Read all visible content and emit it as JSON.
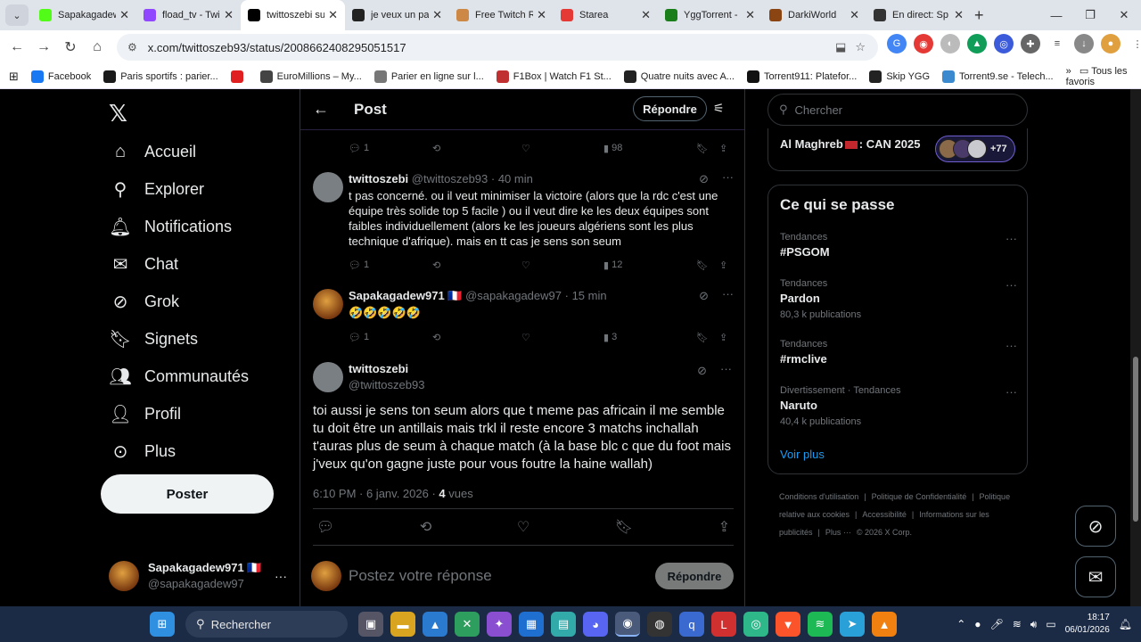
{
  "browser": {
    "tabs": [
      {
        "title": "Sapakagadew",
        "color": "#53fc18"
      },
      {
        "title": "fload_tv - Twi",
        "color": "#9146ff"
      },
      {
        "title": "twittoszebi su",
        "color": "#000000",
        "active": true
      },
      {
        "title": "je veux un pa",
        "color": "#222222"
      },
      {
        "title": "Free Twitch R",
        "color": "#cc8844"
      },
      {
        "title": "Starea",
        "color": "#e53935"
      },
      {
        "title": "YggTorrent -",
        "color": "#1a7f1a"
      },
      {
        "title": "DarkiWorld",
        "color": "#8b4513"
      },
      {
        "title": "En direct: Sp",
        "color": "#333333"
      }
    ],
    "url": "x.com/twittoszeb93/status/2008662408295051517",
    "bookmarks": [
      "Facebook",
      "Paris sportifs : parier...",
      "",
      "EuroMillions – My...",
      "Parier en ligne sur l...",
      "F1Box | Watch F1 St...",
      "Quatre nuits avec A...",
      "Torrent911: Platefor...",
      "Skip YGG",
      "Torrent9.se - Telech..."
    ],
    "bookmarks_all": "Tous les favoris"
  },
  "nav": {
    "items": [
      {
        "label": "Accueil",
        "icon": "home-icon",
        "glyph": "⌂"
      },
      {
        "label": "Explorer",
        "icon": "search-icon",
        "glyph": "⚲"
      },
      {
        "label": "Notifications",
        "icon": "bell-icon",
        "glyph": "🔔︎"
      },
      {
        "label": "Chat",
        "icon": "mail-icon",
        "glyph": "✉"
      },
      {
        "label": "Grok",
        "icon": "grok-icon",
        "glyph": "⊘"
      },
      {
        "label": "Signets",
        "icon": "bookmark-icon",
        "glyph": "🔖︎"
      },
      {
        "label": "Communautés",
        "icon": "communities-icon",
        "glyph": "👥︎"
      },
      {
        "label": "Profil",
        "icon": "profile-icon",
        "glyph": "👤︎"
      },
      {
        "label": "Plus",
        "icon": "more-icon",
        "glyph": "⊙"
      }
    ],
    "post_button": "Poster",
    "account": {
      "display_name": "Sapakagadew971 🇫🇷",
      "handle": "@sapakagadew97"
    }
  },
  "main": {
    "title": "Post",
    "reply_button": "Répondre",
    "top_actions": {
      "replies": "1",
      "views": "98"
    },
    "replies": [
      {
        "name": "twittoszebi",
        "handle": "@twittoszeb93",
        "time": "· 40 min",
        "text": "t pas concerné. ou il veut minimiser la victoire (alors que la rdc c'est une équipe très solide top 5 facile ) ou il veut dire ke les deux équipes sont faibles individuellement (alors ke les joueurs algériens sont les plus technique d'afrique). mais en tt cas je sens son seum",
        "replies": "1",
        "views": "12"
      },
      {
        "name": "Sapakagadew971 🇫🇷",
        "handle": "@sapakagadew97",
        "time": "· 15 min",
        "text": "🤣🤣🤣🤣🤣",
        "replies": "1",
        "views": "3"
      }
    ],
    "focus": {
      "name": "twittoszebi",
      "handle": "@twittoszeb93",
      "text": "toi aussi je sens ton seum alors que t meme pas africain il me semble tu doit être un antillais mais trkl il reste encore 3 matchs inchallah t'auras plus de seum à chaque match (à la base blc c que du foot mais j'veux qu'on gagne juste pour vous foutre la haine wallah)",
      "timestamp": "6:10 PM · 6 janv. 2026 ·",
      "views_count": "4",
      "views_label": "vues"
    },
    "compose_placeholder": "Postez votre réponse",
    "compose_button": "Répondre"
  },
  "right": {
    "search_placeholder": "Chercher",
    "event": {
      "title": "Al Maghreb",
      "title_suffix": ": CAN 2025",
      "count": "+77"
    },
    "trends_title": "Ce qui se passe",
    "trends": [
      {
        "category": "Tendances",
        "name": "#PSGOM",
        "count": ""
      },
      {
        "category": "Tendances",
        "name": "Pardon",
        "count": "80,3 k publications"
      },
      {
        "category": "Tendances",
        "name": "#rmclive",
        "count": ""
      },
      {
        "category": "Divertissement · Tendances",
        "name": "Naruto",
        "count": "40,4 k publications"
      }
    ],
    "show_more": "Voir plus",
    "footer_links": [
      "Conditions d'utilisation",
      "|",
      "Politique de Confidentialité",
      "|",
      "Politique relative aux cookies",
      "|",
      "Accessibilité",
      "|",
      "Informations sur les publicités",
      "|",
      "Plus ···",
      "© 2026 X Corp."
    ]
  },
  "taskbar": {
    "search": "Rechercher",
    "time": "18:17",
    "date": "06/01/2026"
  }
}
